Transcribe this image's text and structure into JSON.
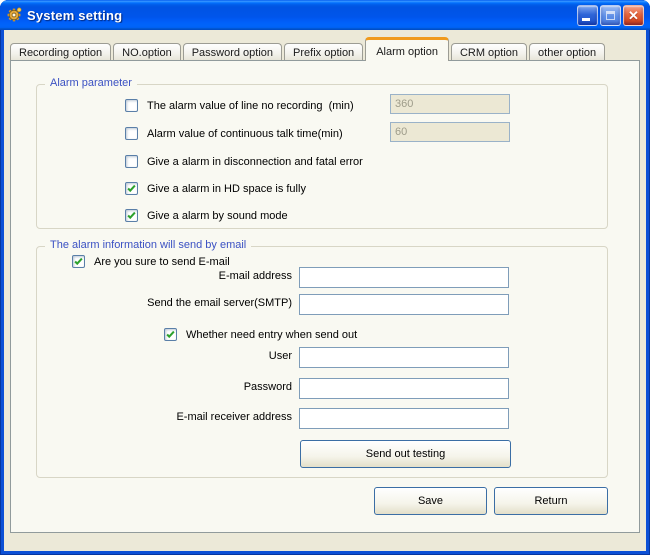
{
  "colors": {
    "titlebar_blue": "#0054E3",
    "window_bg": "#ECE9D8",
    "page_bg": "#F9F9F2",
    "active_tab_accent": "#F09A1D",
    "group_title_blue": "#3B51C3",
    "check_green": "#2DA12D",
    "input_border": "#7F9DB9",
    "disabled_input_bg": "#ECE8D4"
  },
  "window": {
    "title": "System setting"
  },
  "icons": {
    "app": "gear",
    "minimize": "underscore",
    "maximize": "square",
    "close": "✕"
  },
  "tabs": {
    "active_index": 4,
    "items": [
      {
        "label": "Recording option"
      },
      {
        "label": "NO.option"
      },
      {
        "label": "Password option"
      },
      {
        "label": "Prefix option"
      },
      {
        "label": "Alarm option"
      },
      {
        "label": "CRM option"
      },
      {
        "label": "other option"
      }
    ]
  },
  "alarm_parameter": {
    "title": "Alarm parameter",
    "rows": [
      {
        "label": "The alarm value of line no recording  (min)",
        "checked": false,
        "value": "360"
      },
      {
        "label": "Alarm value of continuous talk time(min)",
        "checked": false,
        "value": "60"
      },
      {
        "label": "Give a alarm in disconnection and fatal error",
        "checked": false
      },
      {
        "label": "Give a alarm in HD space is fully",
        "checked": true
      },
      {
        "label": "Give a alarm by sound mode",
        "checked": true
      }
    ]
  },
  "email": {
    "title": "The alarm information will send by email",
    "send_checkbox": {
      "label": "Are you sure to send E-mail",
      "checked": true
    },
    "address_field": {
      "label": "E-mail address",
      "value": ""
    },
    "smtp_field": {
      "label": "Send the email server(SMTP)",
      "value": ""
    },
    "entry_checkbox": {
      "label": "Whether need entry when send out",
      "checked": true
    },
    "user_field": {
      "label": "User",
      "value": ""
    },
    "password_field": {
      "label": "Password",
      "value": ""
    },
    "receiver_field": {
      "label": "E-mail receiver address",
      "value": ""
    },
    "test_button_label": "Send out testing"
  },
  "footer": {
    "save_label": "Save",
    "return_label": "Return"
  }
}
